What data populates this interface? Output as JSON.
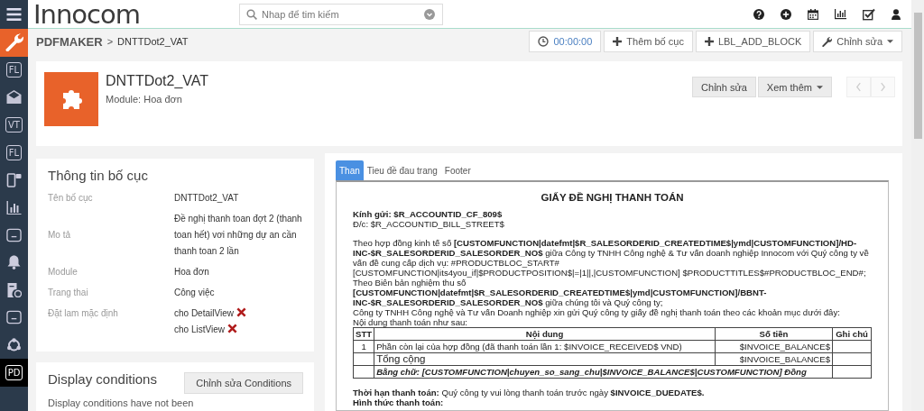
{
  "topbar": {
    "logo": "Innocom",
    "search": {
      "placeholder": "Nhap để tim kiếm"
    }
  },
  "sidebar": {
    "items": [
      {
        "kind": "wrench",
        "selected": true,
        "highlighted": false
      },
      {
        "kind": "badge",
        "label": "FL",
        "selected": false,
        "highlighted": false
      },
      {
        "kind": "envelope",
        "selected": false,
        "highlighted": false
      },
      {
        "kind": "badge",
        "label": "VT",
        "selected": false,
        "highlighted": false
      },
      {
        "kind": "badge",
        "label": "FL",
        "selected": false,
        "highlighted": false
      },
      {
        "kind": "mobile",
        "selected": false,
        "highlighted": false
      },
      {
        "kind": "chart",
        "selected": false,
        "highlighted": false
      },
      {
        "kind": "dots",
        "selected": false,
        "highlighted": false
      },
      {
        "kind": "bell",
        "selected": false,
        "highlighted": false
      },
      {
        "kind": "invoice",
        "selected": false,
        "highlighted": false
      },
      {
        "kind": "dots",
        "selected": false,
        "highlighted": false
      },
      {
        "kind": "network",
        "selected": false,
        "highlighted": false
      },
      {
        "kind": "badge",
        "label": "PD",
        "selected": false,
        "highlighted": true
      }
    ]
  },
  "breadcrumb": {
    "module": "PDFMAKER",
    "separator": ">",
    "current": "DNTTDot2_VAT"
  },
  "toolbar": {
    "timer": "00:00:00",
    "buttons": [
      {
        "label": "Thêm bố cục",
        "kind": "add"
      },
      {
        "label": "LBL_ADD_BLOCK",
        "kind": "add"
      },
      {
        "label": "Chỉnh sửa",
        "kind": "edit-menu"
      }
    ]
  },
  "record": {
    "title": "DNTTDot2_VAT",
    "module": "Module: Hoa đơn",
    "buttons": [
      {
        "label": "Chỉnh sửa",
        "kind": "plain"
      },
      {
        "label": "Xem thêm",
        "kind": "menu"
      }
    ],
    "nav": [
      {
        "kind": "prev",
        "disabled": true
      },
      {
        "kind": "next",
        "disabled": true
      }
    ]
  },
  "info": {
    "title": "Thông tin bố cục",
    "rows": [
      {
        "label": "Tên bố cục",
        "value": "DNTTDot2_VAT"
      },
      {
        "label": "Mo tả",
        "value": "Đề nghị thanh toan đợt 2 (thanh toan hết) vơi những dự an cần thanh toan 2 lần"
      },
      {
        "label": "Module",
        "value": "Hoa đơn"
      },
      {
        "label": "Trang thai",
        "value": "Công việc"
      },
      {
        "label": "Đặt lam mặc định",
        "defaults": [
          {
            "label": "cho DetailView",
            "checked": false
          },
          {
            "label": "cho ListView",
            "checked": false
          }
        ]
      }
    ]
  },
  "conditions": {
    "title": "Display conditions",
    "button": "Chỉnh sửa Conditions",
    "text": "Display conditions have not been"
  },
  "preview": {
    "tabs": [
      {
        "label": "Than",
        "selected": true
      },
      {
        "label": "Tieu đề đau trang",
        "selected": false
      },
      {
        "label": "Footer",
        "selected": false
      }
    ],
    "document": [
      {
        "kind": "title",
        "text": "GIẤY ĐỀ NGHỊ THANH TOÁN"
      },
      {
        "kind": "strong",
        "text": "Kính gửi: $R_ACCOUNTID_CF_809$"
      },
      {
        "kind": "text",
        "text": "Đ/c: $R_ACCOUNTID_BILL_STREET$"
      },
      {
        "kind": "gap"
      },
      {
        "kind": "text",
        "text": "Theo hợp đồng kinh tế số **[CUSTOMFUNCTION|datefmt|$R_SALESORDERID_CREATEDTIME$|ymd|CUSTOMFUNCTION]/HD-INC-$R_SALESORDERID_SALESORDER_NO$** giữa Công ty TNHH Công nghệ & Tư vấn doanh nghiệp Innocom với Quý công ty về vấn đề cung cấp dịch vụ: #PRODUCTBLOC_START#[CUSTOMFUNCTION|its4you_if|$PRODUCTPOSITION$|=|1||,|CUSTOMFUNCTION] $PRODUCTTITLES$#PRODUCTBLOC_END#;"
      },
      {
        "kind": "text",
        "text": "Theo Biên bản nghiệm thu số **[CUSTOMFUNCTION|datefmt|$R_SALESORDERID_CREATEDTIME$|ymd|CUSTOMFUNCTION]/BBNT-INC-$R_SALESORDERID_SALESORDER_NO$** giữa chúng tôi và Quý công ty;"
      },
      {
        "kind": "text",
        "text": "Công ty TNHH Công nghệ và Tư vấn Doanh nghiệp xin gửi Quý công ty giấy đề nghị thanh toán theo các khoản mục dưới đây:"
      },
      {
        "kind": "text",
        "text": "Nội dung thanh toán như sau:"
      },
      {
        "kind": "table",
        "columns": [
          "STT",
          "Nội dung",
          "Số tiền",
          "Ghi chú"
        ],
        "rows": [
          {
            "kind": "item",
            "cells": [
              "1",
              "Phần còn lại của hợp đồng (đã thanh toán lần 1: $INVOICE_RECEIVED$ VND)",
              "$INVOICE_BALANCE$",
              ""
            ]
          },
          {
            "kind": "total",
            "cells": [
              "",
              "Tổng cộng",
              "$INVOICE_BALANCE$",
              ""
            ]
          },
          {
            "kind": "words",
            "cells": [
              "",
              {
                "text": "Bằng chữ: [CUSTOMFUNCTION|chuyen_so_sang_chu|$INVOICE_BALANCE$|CUSTOMFUNCTION] Đồng",
                "colspan": 2
              },
              ""
            ]
          }
        ]
      },
      {
        "kind": "gap"
      },
      {
        "kind": "text",
        "text": "**Thời hạn thanh toán:** Quý công ty vui lòng thanh toán trước ngày **$INVOICE_DUEDATE$.**"
      },
      {
        "kind": "strong",
        "text": "Hình thức thanh toán:"
      }
    ]
  }
}
